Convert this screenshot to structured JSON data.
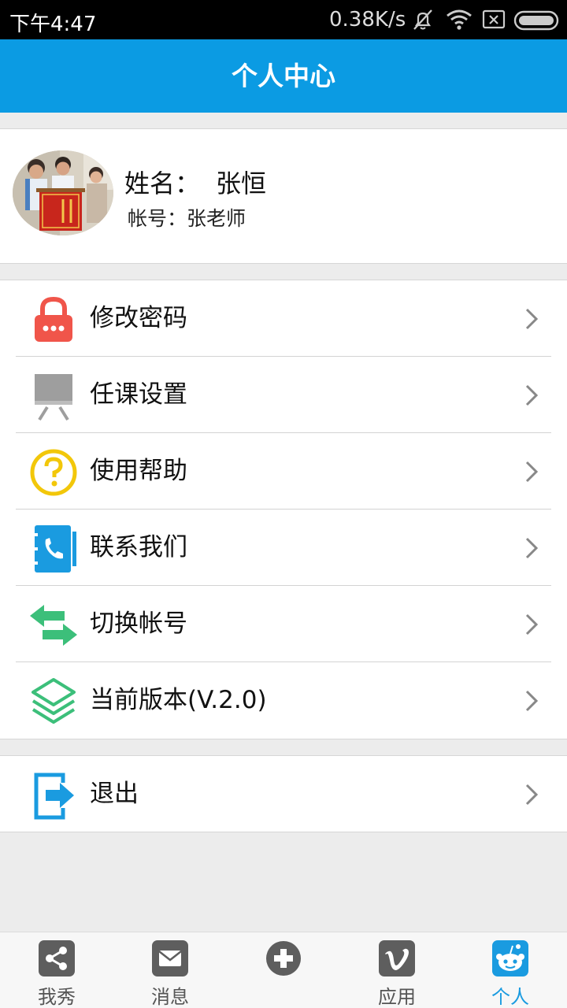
{
  "status_bar": {
    "time": "下午4:47",
    "net_speed": "0.38K/s",
    "icons": [
      "mute-bell-icon",
      "wifi-icon",
      "sim-x-icon",
      "battery-icon"
    ]
  },
  "header": {
    "title": "个人中心"
  },
  "profile": {
    "name_label": "姓名：",
    "name_value": "张恒",
    "account": "帐号：张老师"
  },
  "menu": [
    {
      "label": "修改密码",
      "icon": "lock-icon",
      "icon_color": "#f0554a"
    },
    {
      "label": "任课设置",
      "icon": "easel-icon",
      "icon_color": "#9e9e9e"
    },
    {
      "label": "使用帮助",
      "icon": "help-circle-icon",
      "icon_color": "#f2c70a"
    },
    {
      "label": "联系我们",
      "icon": "contact-book-icon",
      "icon_color": "#1a9be0"
    },
    {
      "label": "切换帐号",
      "icon": "switch-arrows-icon",
      "icon_color": "#3cbf7a"
    },
    {
      "label": "当前版本(V.2.0)",
      "icon": "layers-icon",
      "icon_color": "#3cbf7a"
    }
  ],
  "logout": {
    "label": "退出",
    "icon": "exit-icon",
    "icon_color": "#1a9be0"
  },
  "bottom_nav": [
    {
      "label": "我秀",
      "icon": "share-icon"
    },
    {
      "label": "消息",
      "icon": "envelope-icon"
    },
    {
      "label": "",
      "icon": "plus-circle-icon"
    },
    {
      "label": "应用",
      "icon": "vimeo-icon"
    },
    {
      "label": "个人",
      "icon": "robot-face-icon",
      "active": true
    }
  ],
  "colors": {
    "brand": "#0b9be3",
    "active_tab": "#1a9be0"
  }
}
